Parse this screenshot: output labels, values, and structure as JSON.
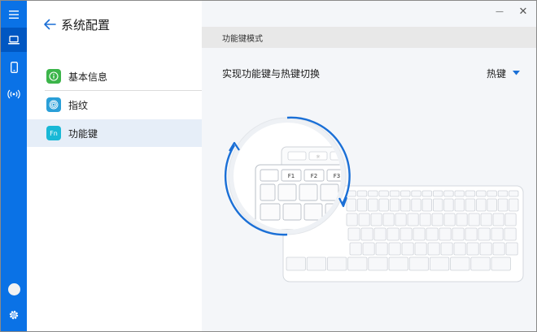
{
  "window": {
    "close_glyph": "✕",
    "minimize_glyph": "—"
  },
  "rail": {
    "accent": "#0a72e6",
    "items": [
      {
        "icon": "menu-icon"
      },
      {
        "icon": "laptop-icon",
        "active": true
      },
      {
        "icon": "phone-icon"
      },
      {
        "icon": "wireless-icon"
      },
      {
        "icon": "avatar"
      },
      {
        "icon": "gear-icon"
      }
    ]
  },
  "nav": {
    "title": "系统配置",
    "items": [
      {
        "label": "基本信息",
        "icon": "info-icon",
        "icon_color": "#3cb54a"
      },
      {
        "label": "指纹",
        "icon": "fingerprint-icon",
        "icon_color": "#2a9fd8"
      },
      {
        "label": "功能键",
        "icon": "fn-key-icon",
        "icon_color": "#19b8d6",
        "icon_text": "Fn",
        "selected": true
      }
    ]
  },
  "main": {
    "section_title": "功能键模式",
    "setting_label": "实现功能键与热键切换",
    "dropdown_value": "热键",
    "illustration": {
      "key_labels": [
        "F1",
        "F2",
        "F3"
      ],
      "arrow_color": "#1a6fd6"
    }
  }
}
